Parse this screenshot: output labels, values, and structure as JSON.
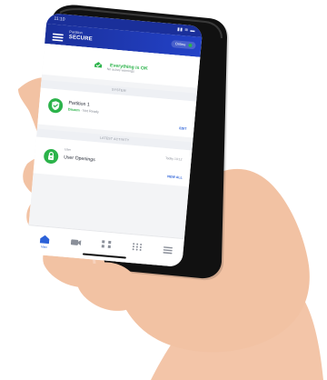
{
  "colors": {
    "primary": "#1a2f9a",
    "primary_accent": "#2342c8",
    "ok_green": "#2bb34a",
    "link_blue": "#2b61d8",
    "phone_black": "#111111",
    "skin": "#f2c2a3"
  },
  "status": {
    "time": "11:10",
    "right_indicators": "▮▮ ≋ ▬"
  },
  "appbar": {
    "subtitle": "Partition",
    "title": "SECURE",
    "badge": "Online"
  },
  "summary": {
    "status_text": "Everything is OK",
    "subtext": "No active warnings"
  },
  "sections": {
    "partitions_header": "SYSTEM",
    "activity_header": "LATEST ACTIVITY"
  },
  "partition": {
    "name": "Partition 1",
    "state": "Disarm",
    "state_detail": "· Not Ready",
    "action": "EDIT"
  },
  "activity": {
    "meta_small": "User",
    "meta_time": "Today 10:12",
    "title": "User Openings",
    "action": "VIEW ALL"
  },
  "bottom_nav": [
    {
      "icon": "home-icon",
      "label": "Main"
    },
    {
      "icon": "camera-icon",
      "label": ""
    },
    {
      "icon": "automation-icon",
      "label": ""
    },
    {
      "icon": "keypad-icon",
      "label": ""
    },
    {
      "icon": "menu-icon",
      "label": ""
    }
  ]
}
